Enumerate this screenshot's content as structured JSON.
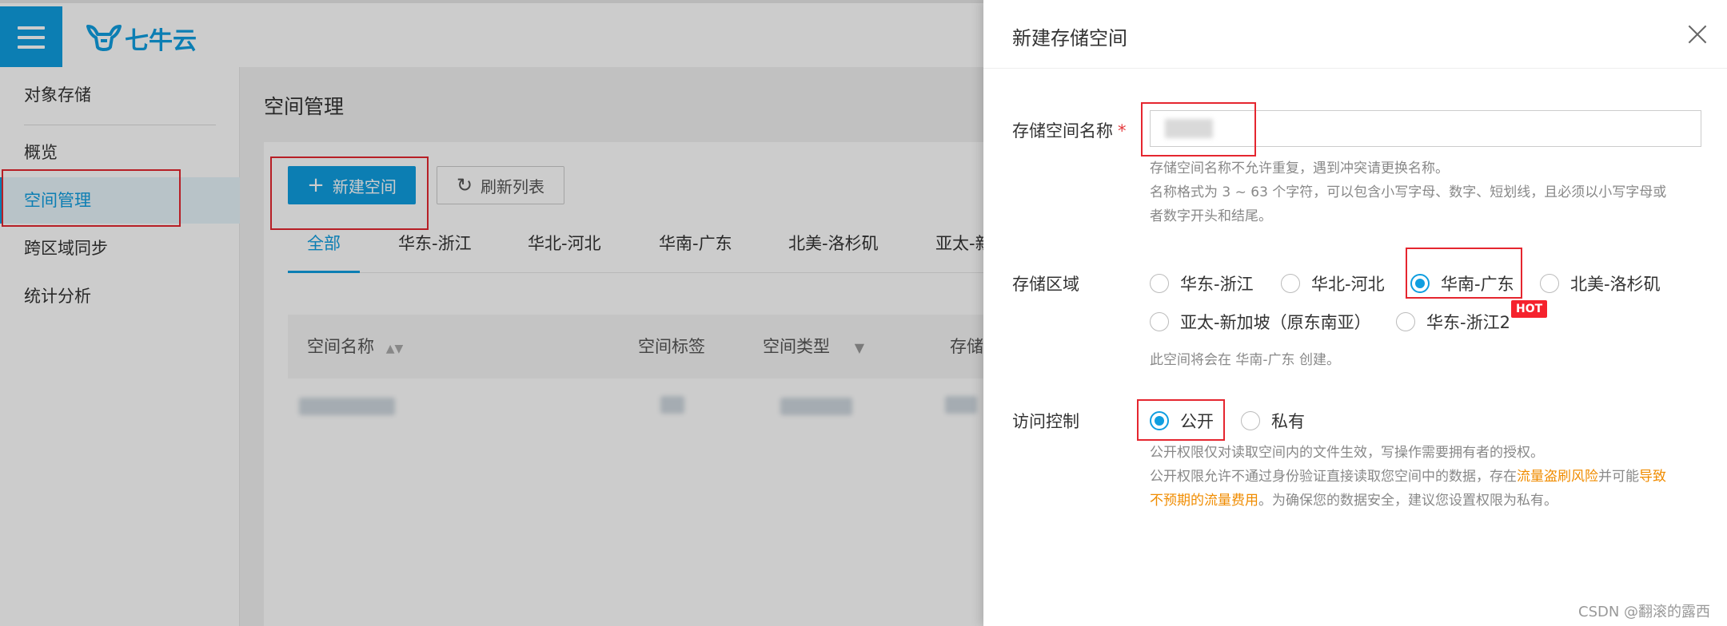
{
  "brand": {
    "logo_text": "七牛云"
  },
  "sidebar": {
    "items": [
      {
        "label": "对象存储"
      },
      {
        "label": "概览"
      },
      {
        "label": "空间管理"
      },
      {
        "label": "跨区域同步"
      },
      {
        "label": "统计分析"
      }
    ]
  },
  "main": {
    "page_title": "空间管理",
    "new_button": "新建空间",
    "refresh_button": "刷新列表",
    "tabs": [
      "全部",
      "华东-浙江",
      "华北-河北",
      "华南-广东",
      "北美-洛杉矶",
      "亚太-新"
    ],
    "table_headers": [
      "空间名称",
      "空间标签",
      "空间类型",
      "存储"
    ]
  },
  "drawer": {
    "title": "新建存储空间",
    "name_label": "存储空间名称",
    "required_mark": "*",
    "name_hint_1": "存储空间名称不允许重复，遇到冲突请更换名称。",
    "name_hint_2": "名称格式为 3 ~ 63 个字符，可以包含小写字母、数字、短划线，且必须以小写字母或",
    "name_hint_3": "者数字开头和结尾。",
    "region_label": "存储区域",
    "regions": [
      "华东-浙江",
      "华北-河北",
      "华南-广东",
      "北美-洛杉矶",
      "亚太-新加坡（原东南亚）",
      "华东-浙江2"
    ],
    "selected_region": "华南-广东",
    "hot_badge": "HOT",
    "region_hint": "此空间将会在 华南-广东 创建。",
    "access_label": "访问控制",
    "access_options": [
      "公开",
      "私有"
    ],
    "selected_access": "公开",
    "access_hint_1": "公开权限仅对读取空间内的文件生效，写操作需要拥有者的授权。",
    "access_hint_2a": "公开权限允许不通过身份验证直接读取您空间中的数据，存在",
    "access_hint_2b": "流量盗刷风险",
    "access_hint_2c": "并可能",
    "access_hint_2d": "导致",
    "access_hint_3a": "不预期的流量费用",
    "access_hint_3b": "。为确保您的数据安全，建议您设置权限为私有。"
  },
  "watermark": "CSDN @翻滚的露西",
  "colors": {
    "accent": "#0f9ee0",
    "highlight": "#e5262f",
    "warning": "#f08c00"
  }
}
